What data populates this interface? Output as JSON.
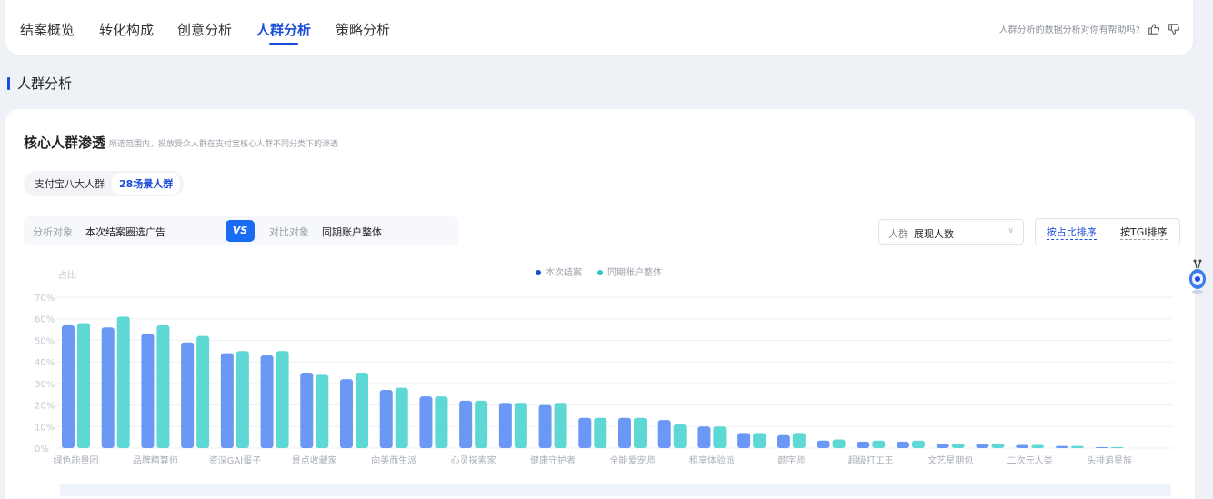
{
  "tabs": [
    {
      "label": "结案概览",
      "active": false
    },
    {
      "label": "转化构成",
      "active": false
    },
    {
      "label": "创意分析",
      "active": false
    },
    {
      "label": "人群分析",
      "active": true
    },
    {
      "label": "策略分析",
      "active": false
    }
  ],
  "feedback": {
    "question": "人群分析的数据分析对你有帮助吗?",
    "like_icon": "thumbs-up-icon",
    "dislike_icon": "thumbs-down-icon"
  },
  "section": {
    "title": "人群分析"
  },
  "card": {
    "title": "核心人群渗透",
    "subtitle": "所选范围内，投放受众人群在支付宝核心人群不同分类下的渗透"
  },
  "segment": {
    "options": [
      "支付宝八大人群",
      "28场景人群"
    ],
    "selected": "28场景人群"
  },
  "compare": {
    "target_label": "分析对象",
    "target_value": "本次结案圈选广告",
    "vs": "VS",
    "contrast_label": "对比对象",
    "contrast_value": "同期账户整体"
  },
  "metric_select": {
    "label": "人群",
    "value": "展现人数"
  },
  "sort": {
    "by_share": "按占比排序",
    "by_tgi": "按TGI排序",
    "active": "by_share"
  },
  "colors": {
    "primary": "#1a4dd8",
    "series_a": "#6b97f5",
    "series_b": "#5dd8d4"
  },
  "chart_data": {
    "type": "bar",
    "ylabel": "占比",
    "yticks": [
      "0%",
      "10%",
      "20%",
      "30%",
      "40%",
      "50%",
      "60%",
      "70%"
    ],
    "ylim": [
      0,
      70
    ],
    "legend_position": "top-center",
    "grid": true,
    "categories": [
      "绿色能量团",
      "",
      "品牌精算师",
      "",
      "资深GAI蛋子",
      "",
      "景点收藏家",
      "",
      "向美而生派",
      "",
      "心灵探索家",
      "",
      "健康守护者",
      "",
      "全能爱宠师",
      "",
      "租享体验派",
      "",
      "颜字师",
      "",
      "超级打工王",
      "",
      "文艺星期包",
      "",
      "二次元人类",
      "",
      "头排追星族",
      ""
    ],
    "series": [
      {
        "name": "本次结案",
        "values": [
          57,
          56,
          53,
          49,
          44,
          43,
          35,
          32,
          27,
          24,
          22,
          21,
          20,
          14,
          14,
          13,
          10,
          7,
          6,
          3.5,
          3,
          3,
          2,
          2,
          1.5,
          1,
          0.5
        ]
      },
      {
        "name": "同期账户整体",
        "values": [
          58,
          61,
          57,
          52,
          45,
          45,
          34,
          35,
          28,
          24,
          22,
          21,
          21,
          14,
          14,
          11,
          10,
          7,
          7,
          4,
          3.5,
          3.5,
          2,
          2,
          1.5,
          1,
          0.5
        ]
      }
    ]
  }
}
